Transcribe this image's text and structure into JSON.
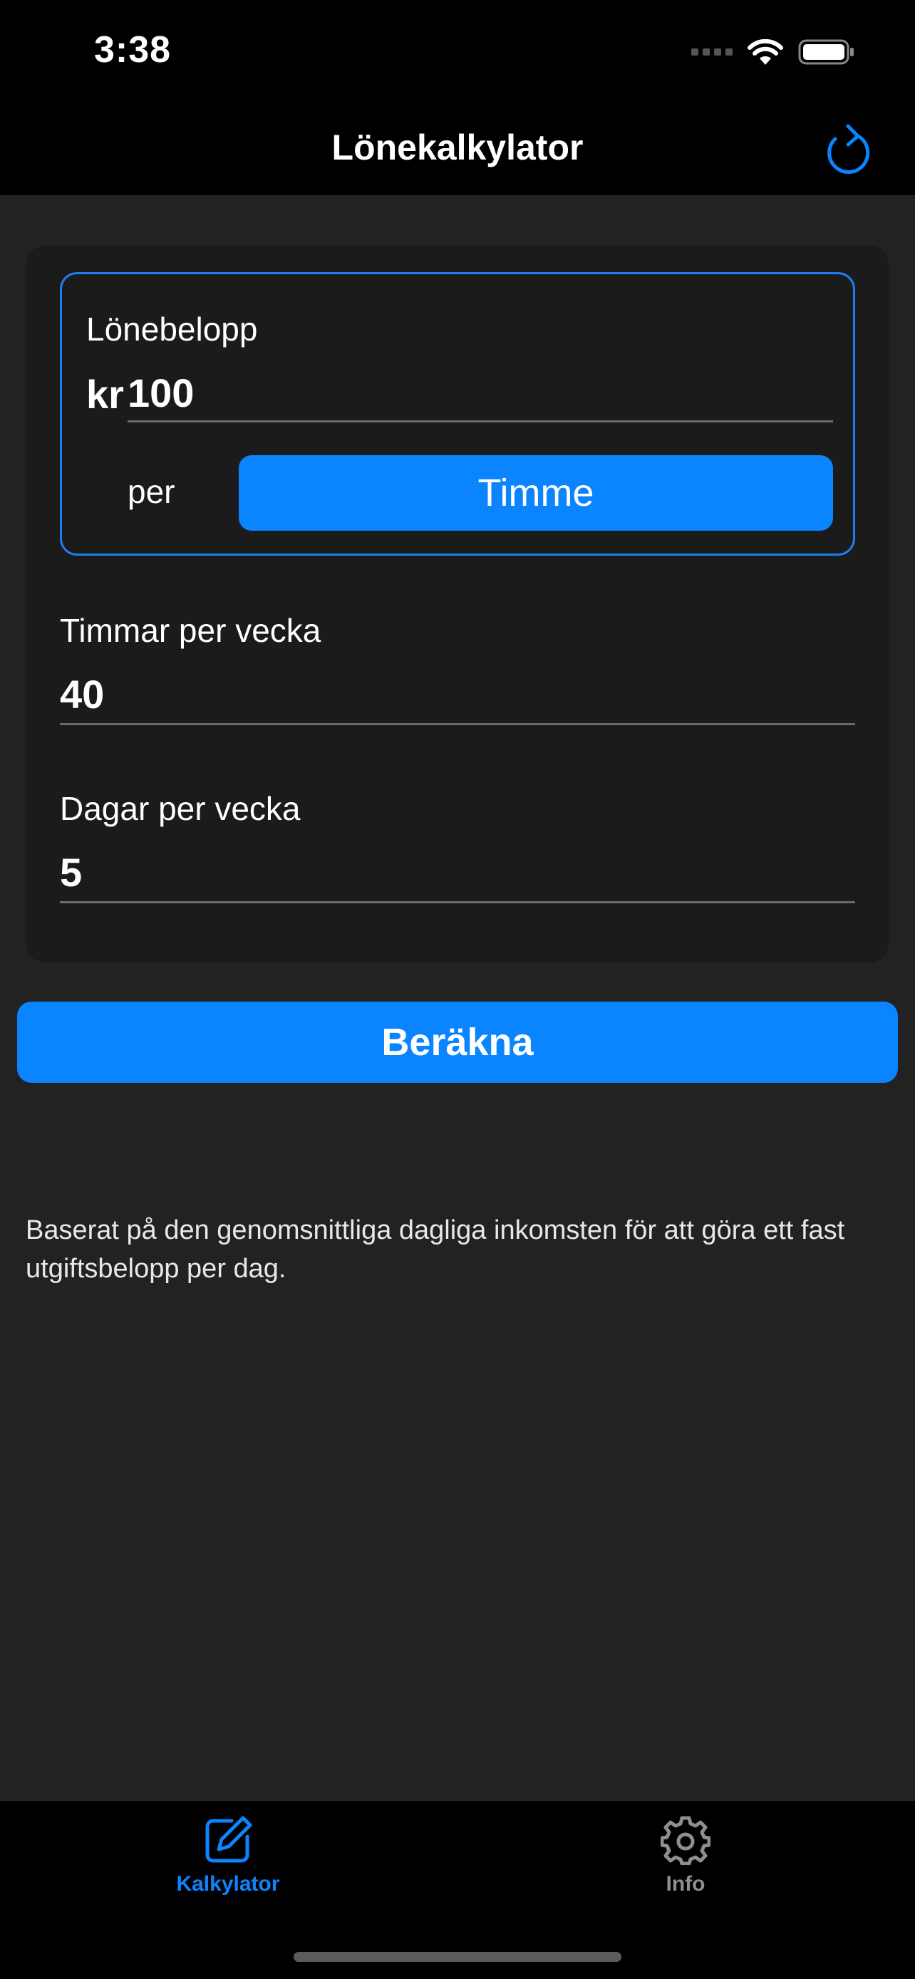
{
  "status_bar": {
    "time": "3:38"
  },
  "nav": {
    "title": "Lönekalkylator",
    "refresh_icon": "refresh-icon"
  },
  "salary": {
    "label": "Lönebelopp",
    "currency": "kr",
    "value": "100",
    "per_label": "per",
    "period": "Timme"
  },
  "hours": {
    "label": "Timmar per vecka",
    "value": "40"
  },
  "days": {
    "label": "Dagar per vecka",
    "value": "5"
  },
  "calculate_label": "Beräkna",
  "info_text": "Baserat på den genomsnittliga dagliga inkomsten för att göra ett fast utgiftsbelopp per dag.",
  "tabs": [
    {
      "label": "Kalkylator",
      "icon": "edit-icon",
      "active": true
    },
    {
      "label": "Info",
      "icon": "gear-icon",
      "active": false
    }
  ],
  "colors": {
    "accent": "#0a84ff",
    "background": "#222222",
    "card": "#1b1b1c",
    "inactive": "#8e8e93"
  }
}
